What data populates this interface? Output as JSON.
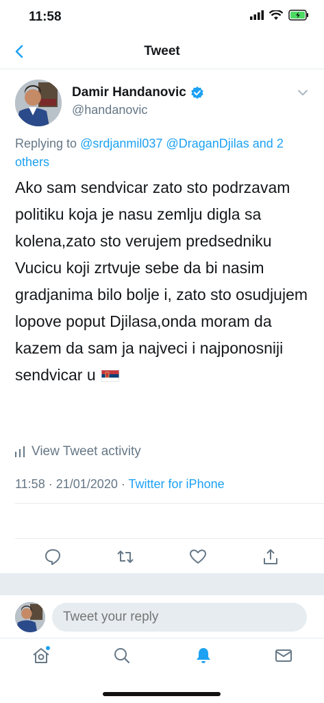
{
  "status_bar": {
    "time": "11:58"
  },
  "nav": {
    "title": "Tweet"
  },
  "tweet": {
    "author_name": "Damir Handanovic",
    "author_handle": "@handanovic",
    "replying_prefix": "Replying to",
    "replying_users": [
      "@srdjanmil037",
      "@DraganDjilas"
    ],
    "replying_and": "and",
    "replying_others": "2 others",
    "text": "Ako sam sendvicar zato sto podrzavam politiku koja je nasu zemlju digla sa kolena,zato sto verujem predsedniku Vucicu koji zrtvuje sebe da bi nasim gradjanima bilo bolje i, zato sto osudjujem lopove poput Djilasa,onda moram da kazem da sam ja najveci i najponosniji sendvicar u",
    "time": "11:58",
    "date": "21/01/2020",
    "separator": "·",
    "source": "Twitter for iPhone",
    "activity_label": "View Tweet activity"
  },
  "compose": {
    "placeholder": "Tweet your reply"
  },
  "icons": {
    "back": "chevron-left-icon",
    "verified": "verified-badge-icon",
    "caret": "chevron-down-icon",
    "flag": "serbia-flag-icon",
    "reply": "reply-icon",
    "retweet": "retweet-icon",
    "like": "heart-icon",
    "share": "share-icon",
    "home": "home-icon",
    "search": "search-icon",
    "notifications": "bell-icon",
    "messages": "mail-icon"
  },
  "colors": {
    "accent": "#1da1f2",
    "text": "#14171a",
    "secondary": "#657786",
    "battery": "#4cd964"
  }
}
